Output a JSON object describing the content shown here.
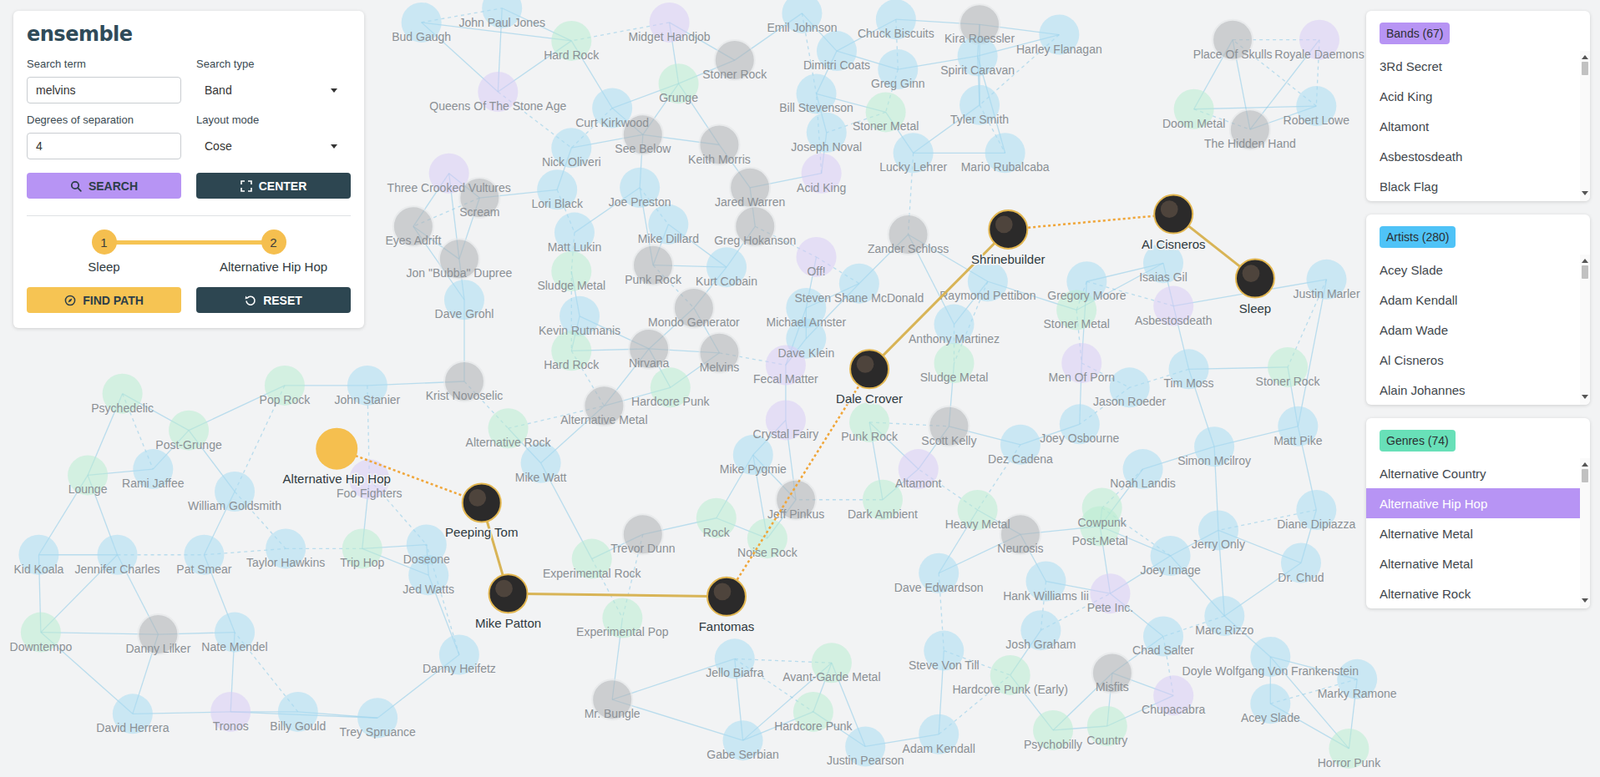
{
  "app": {
    "logo": "ensemble"
  },
  "search": {
    "term_label": "Search term",
    "term_value": "melvins",
    "type_label": "Search type",
    "type_value": "Band",
    "degrees_label": "Degrees of separation",
    "degrees_value": "4",
    "layout_label": "Layout mode",
    "layout_value": "Cose"
  },
  "buttons": {
    "search": "SEARCH",
    "center": "CENTER",
    "find_path": "FIND PATH",
    "reset": "RESET"
  },
  "path": {
    "start": {
      "number": "1",
      "label": "Sleep"
    },
    "end": {
      "number": "2",
      "label": "Alternative Hip Hop"
    }
  },
  "lists": [
    {
      "title": "Bands (67)",
      "color": "#b794f4",
      "items": [
        {
          "label": "3Rd Secret",
          "selected": false
        },
        {
          "label": "Acid King",
          "selected": false
        },
        {
          "label": "Altamont",
          "selected": false
        },
        {
          "label": "Asbestosdeath",
          "selected": false
        },
        {
          "label": "Black Flag",
          "selected": false
        }
      ]
    },
    {
      "title": "Artists (280)",
      "color": "#4fc3f7",
      "items": [
        {
          "label": "Acey Slade",
          "selected": false
        },
        {
          "label": "Adam Kendall",
          "selected": false
        },
        {
          "label": "Adam Wade",
          "selected": false
        },
        {
          "label": "Al Cisneros",
          "selected": false
        },
        {
          "label": "Alain Johannes",
          "selected": false
        }
      ]
    },
    {
      "title": "Genres (74)",
      "color": "#68e0b8",
      "items": [
        {
          "label": "Alternative Country",
          "selected": false
        },
        {
          "label": "Alternative Hip Hop",
          "selected": true
        },
        {
          "label": "Alternative Metal",
          "selected": false
        },
        {
          "label": "Alternative Metal",
          "selected": false
        },
        {
          "label": "Alternative Rock",
          "selected": false
        }
      ]
    }
  ],
  "graph": {
    "path_nodes": [
      {
        "label": "Alternative Hip Hop",
        "kind": "genre"
      },
      {
        "label": "Peeping Tom",
        "kind": "photo"
      },
      {
        "label": "Mike Patton",
        "kind": "photo"
      },
      {
        "label": "Fantomas",
        "kind": "photo"
      },
      {
        "label": "Dale Crover",
        "kind": "photo"
      },
      {
        "label": "Shrinebuilder",
        "kind": "photo"
      },
      {
        "label": "Al Cisneros",
        "kind": "photo"
      },
      {
        "label": "Sleep",
        "kind": "photo"
      }
    ],
    "path_edges": [
      {
        "from": "Alternative Hip Hop",
        "to": "Peeping Tom",
        "dashed": true
      },
      {
        "from": "Peeping Tom",
        "to": "Mike Patton",
        "dashed": false
      },
      {
        "from": "Mike Patton",
        "to": "Fantomas",
        "dashed": false
      },
      {
        "from": "Fantomas",
        "to": "Dale Crover",
        "dashed": true
      },
      {
        "from": "Dale Crover",
        "to": "Shrinebuilder",
        "dashed": false
      },
      {
        "from": "Shrinebuilder",
        "to": "Al Cisneros",
        "dashed": true
      },
      {
        "from": "Al Cisneros",
        "to": "Sleep",
        "dashed": false
      }
    ],
    "background_nodes": [
      {
        "label": "Bud Gaugh",
        "kind": "artist"
      },
      {
        "label": "John Paul Jones",
        "kind": "artist"
      },
      {
        "label": "Midget Handjob",
        "kind": "band"
      },
      {
        "label": "Emil Johnson",
        "kind": "artist"
      },
      {
        "label": "Chuck Biscuits",
        "kind": "artist"
      },
      {
        "label": "Kira Roessler",
        "kind": "photo"
      },
      {
        "label": "Harley Flanagan",
        "kind": "artist"
      },
      {
        "label": "Place Of Skulls",
        "kind": "photo"
      },
      {
        "label": "Royale Daemons",
        "kind": "band"
      },
      {
        "label": "Hard Rock",
        "kind": "genre"
      },
      {
        "label": "Stoner Rock",
        "kind": "photo"
      },
      {
        "label": "Dimitri Coats",
        "kind": "artist"
      },
      {
        "label": "Greg Ginn",
        "kind": "artist"
      },
      {
        "label": "Spirit Caravan",
        "kind": "artist"
      },
      {
        "label": "Queens Of The Stone Age",
        "kind": "band"
      },
      {
        "label": "Curt Kirkwood",
        "kind": "artist"
      },
      {
        "label": "Grunge",
        "kind": "genre"
      },
      {
        "label": "Bill Stevenson",
        "kind": "artist"
      },
      {
        "label": "Stoner Metal",
        "kind": "genre"
      },
      {
        "label": "Tyler Smith",
        "kind": "artist"
      },
      {
        "label": "Doom Metal",
        "kind": "genre"
      },
      {
        "label": "The Hidden Hand",
        "kind": "photo"
      },
      {
        "label": "Robert Lowe",
        "kind": "artist"
      },
      {
        "label": "Nick Oliveri",
        "kind": "artist"
      },
      {
        "label": "See Below",
        "kind": "photo"
      },
      {
        "label": "Keith Morris",
        "kind": "photo"
      },
      {
        "label": "Joseph Noval",
        "kind": "artist"
      },
      {
        "label": "Lucky Lehrer",
        "kind": "artist"
      },
      {
        "label": "Mario Rubalcaba",
        "kind": "artist"
      },
      {
        "label": "Three Crooked Vultures",
        "kind": "band"
      },
      {
        "label": "Scream",
        "kind": "photo"
      },
      {
        "label": "Lori Black",
        "kind": "artist"
      },
      {
        "label": "Joe Preston",
        "kind": "artist"
      },
      {
        "label": "Jared Warren",
        "kind": "photo"
      },
      {
        "label": "Acid King",
        "kind": "band"
      },
      {
        "label": "Eyes Adrift",
        "kind": "photo"
      },
      {
        "label": "Matt Lukin",
        "kind": "artist"
      },
      {
        "label": "Mike Dillard",
        "kind": "artist"
      },
      {
        "label": "Greg Hokanson",
        "kind": "photo"
      },
      {
        "label": "Zander Schloss",
        "kind": "photo"
      },
      {
        "label": "Off!",
        "kind": "band"
      },
      {
        "label": "Jon \"Bubba\" Dupree",
        "kind": "photo"
      },
      {
        "label": "Sludge Metal",
        "kind": "genre"
      },
      {
        "label": "Punk Rock",
        "kind": "photo"
      },
      {
        "label": "Kurt Cobain",
        "kind": "artist"
      },
      {
        "label": "Dave Grohl",
        "kind": "artist"
      },
      {
        "label": "Steven Shane McDonald",
        "kind": "artist"
      },
      {
        "label": "Raymond Pettibon",
        "kind": "artist"
      },
      {
        "label": "Gregory Moore",
        "kind": "artist"
      },
      {
        "label": "Isaias Gil",
        "kind": "artist"
      },
      {
        "label": "Asbestosdeath",
        "kind": "band"
      },
      {
        "label": "Stoner Metal",
        "kind": "genre"
      },
      {
        "label": "Justin Marler",
        "kind": "artist"
      },
      {
        "label": "Kevin Rutmanis",
        "kind": "artist"
      },
      {
        "label": "Mondo Generator",
        "kind": "photo"
      },
      {
        "label": "Michael Amster",
        "kind": "artist"
      },
      {
        "label": "Anthony Martinez",
        "kind": "artist"
      },
      {
        "label": "Nirvana",
        "kind": "photo"
      },
      {
        "label": "Melvins",
        "kind": "photo"
      },
      {
        "label": "Hard Rock",
        "kind": "genre"
      },
      {
        "label": "Dave Klein",
        "kind": "artist"
      },
      {
        "label": "Fecal Matter",
        "kind": "band"
      },
      {
        "label": "Sludge Metal",
        "kind": "genre"
      },
      {
        "label": "Men Of Porn",
        "kind": "band"
      },
      {
        "label": "Tim Moss",
        "kind": "artist"
      },
      {
        "label": "Stoner Rock",
        "kind": "genre"
      },
      {
        "label": "Pop Rock",
        "kind": "genre"
      },
      {
        "label": "John Stanier",
        "kind": "artist"
      },
      {
        "label": "Krist Novoselic",
        "kind": "photo"
      },
      {
        "label": "Hardcore Punk",
        "kind": "genre"
      },
      {
        "label": "Jason Roeder",
        "kind": "artist"
      },
      {
        "label": "Psychedelic",
        "kind": "genre"
      },
      {
        "label": "Alternative Metal",
        "kind": "photo"
      },
      {
        "label": "Crystal Fairy",
        "kind": "band"
      },
      {
        "label": "Punk Rock",
        "kind": "genre"
      },
      {
        "label": "Scott Kelly",
        "kind": "photo"
      },
      {
        "label": "Joey Osbourne",
        "kind": "artist"
      },
      {
        "label": "Matt Pike",
        "kind": "artist"
      },
      {
        "label": "Alternative Rock",
        "kind": "genre"
      },
      {
        "label": "Post-Grunge",
        "kind": "genre"
      },
      {
        "label": "Mike Pygmie",
        "kind": "artist"
      },
      {
        "label": "Altamont",
        "kind": "band"
      },
      {
        "label": "Dez Cadena",
        "kind": "artist"
      },
      {
        "label": "Simon Mcilroy",
        "kind": "artist"
      },
      {
        "label": "Noah Landis",
        "kind": "artist"
      },
      {
        "label": "Rami Jaffee",
        "kind": "artist"
      },
      {
        "label": "William Goldsmith",
        "kind": "artist"
      },
      {
        "label": "Foo Fighters",
        "kind": "band"
      },
      {
        "label": "Lounge",
        "kind": "genre"
      },
      {
        "label": "Mike Watt",
        "kind": "artist"
      },
      {
        "label": "Cowpunk",
        "kind": "genre"
      },
      {
        "label": "Heavy Metal",
        "kind": "genre"
      },
      {
        "label": "Neurosis",
        "kind": "photo"
      },
      {
        "label": "Post-Metal",
        "kind": "genre"
      },
      {
        "label": "Diane Dipiazza",
        "kind": "artist"
      },
      {
        "label": "Jerry Only",
        "kind": "artist"
      },
      {
        "label": "Joey Image",
        "kind": "artist"
      },
      {
        "label": "Dr. Chud",
        "kind": "artist"
      },
      {
        "label": "Dark Ambient",
        "kind": "genre"
      },
      {
        "label": "Jeff Pinkus",
        "kind": "photo"
      },
      {
        "label": "Noise Rock",
        "kind": "genre"
      },
      {
        "label": "Rock",
        "kind": "genre"
      },
      {
        "label": "Trevor Dunn",
        "kind": "photo"
      },
      {
        "label": "Experimental Rock",
        "kind": "genre"
      },
      {
        "label": "Experimental Pop",
        "kind": "genre"
      },
      {
        "label": "Kid Koala",
        "kind": "artist"
      },
      {
        "label": "Jennifer Charles",
        "kind": "artist"
      },
      {
        "label": "Pat Smear",
        "kind": "artist"
      },
      {
        "label": "Taylor Hawkins",
        "kind": "artist"
      },
      {
        "label": "Trip Hop",
        "kind": "genre"
      },
      {
        "label": "Doseone",
        "kind": "artist"
      },
      {
        "label": "Jed Watts",
        "kind": "artist"
      },
      {
        "label": "Downtempo",
        "kind": "genre"
      },
      {
        "label": "Danny Lilker",
        "kind": "photo"
      },
      {
        "label": "Nate Mendel",
        "kind": "artist"
      },
      {
        "label": "Dave Edwardson",
        "kind": "artist"
      },
      {
        "label": "Hank Williams Iii",
        "kind": "artist"
      },
      {
        "label": "Pete Inc.",
        "kind": "band"
      },
      {
        "label": "Josh Graham",
        "kind": "artist"
      },
      {
        "label": "Marc Rizzo",
        "kind": "artist"
      },
      {
        "label": "Chad Salter",
        "kind": "artist"
      },
      {
        "label": "Doyle Wolfgang Von Frankenstein",
        "kind": "artist"
      },
      {
        "label": "Marky Ramone",
        "kind": "artist"
      },
      {
        "label": "Misfits",
        "kind": "photo"
      },
      {
        "label": "Chupacabra",
        "kind": "band"
      },
      {
        "label": "Acey Slade",
        "kind": "artist"
      },
      {
        "label": "Country",
        "kind": "genre"
      },
      {
        "label": "Horror Punk",
        "kind": "genre"
      },
      {
        "label": "Steve Von Till",
        "kind": "artist"
      },
      {
        "label": "Hardcore Punk (Early)",
        "kind": "genre"
      },
      {
        "label": "Avant-Garde Metal",
        "kind": "genre"
      },
      {
        "label": "Jello Biafra",
        "kind": "artist"
      },
      {
        "label": "Mr. Bungle",
        "kind": "photo"
      },
      {
        "label": "Hardcore Punk",
        "kind": "genre"
      },
      {
        "label": "Adam Kendall",
        "kind": "artist"
      },
      {
        "label": "Psychobilly",
        "kind": "genre"
      },
      {
        "label": "Justin Pearson",
        "kind": "artist"
      },
      {
        "label": "Gabe Serbian",
        "kind": "artist"
      },
      {
        "label": "Billy Gould",
        "kind": "artist"
      },
      {
        "label": "Tronos",
        "kind": "band"
      },
      {
        "label": "Trey Spruance",
        "kind": "artist"
      },
      {
        "label": "David Herrera",
        "kind": "artist"
      },
      {
        "label": "Danny Heifetz",
        "kind": "artist"
      }
    ]
  }
}
